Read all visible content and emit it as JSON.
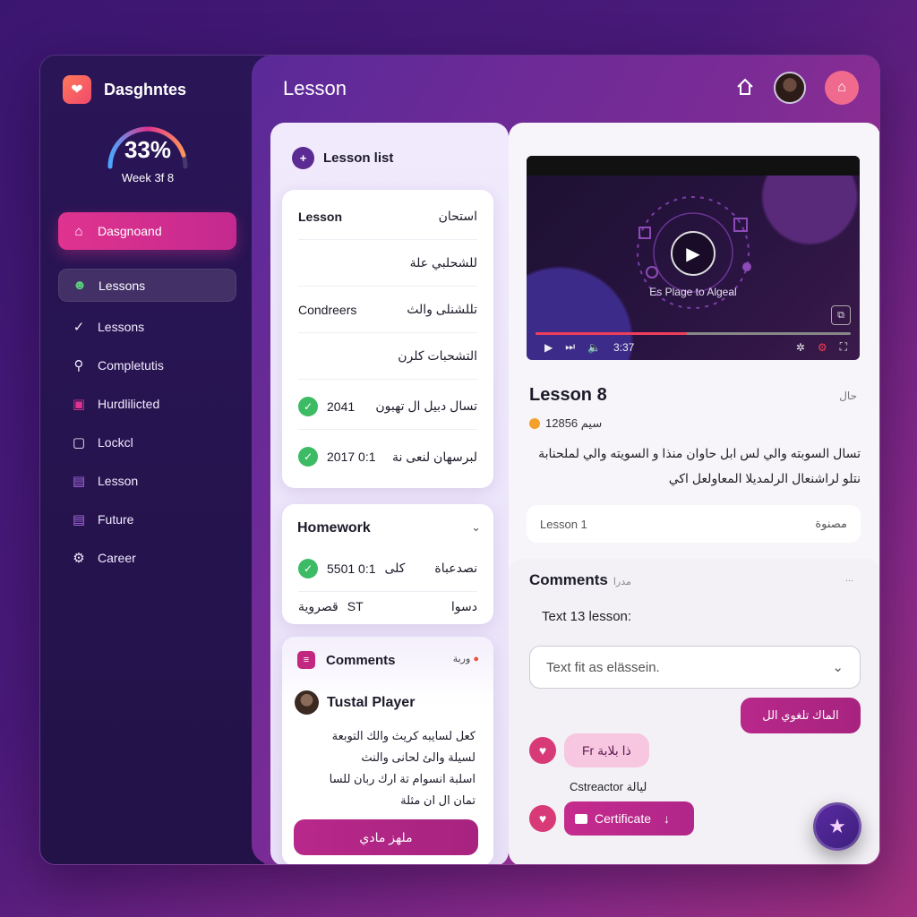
{
  "brand": {
    "name": "Dasghntes",
    "accent": "#e0338f"
  },
  "progress": {
    "percent_label": "33%",
    "fraction": 0.33,
    "week_label": "Week 3f 8"
  },
  "sidebar": {
    "items": [
      {
        "label": "Dasgnoand",
        "icon": "home-icon"
      },
      {
        "label": "Lessons",
        "icon": "people-icon"
      },
      {
        "label": "Lessons",
        "icon": "check-icon"
      },
      {
        "label": "Completutis",
        "icon": "search-icon"
      },
      {
        "label": "Hurdlilicted",
        "icon": "badge-icon"
      },
      {
        "label": "Lockcl",
        "icon": "lock-icon"
      },
      {
        "label": "Lesson",
        "icon": "lock-icon"
      },
      {
        "label": "Future",
        "icon": "lock-icon"
      },
      {
        "label": "Career",
        "icon": "gear-icon"
      }
    ]
  },
  "header": {
    "title": "Lesson"
  },
  "lesson_list": {
    "title": "Lesson list",
    "rows": [
      {
        "left": "Lesson",
        "right": "استحان"
      },
      {
        "left": "",
        "right": "للشحلبي علة"
      },
      {
        "left": "Condreers",
        "right": "تللشنلى والث"
      },
      {
        "left": "",
        "right": "التشحبات كلرن"
      },
      {
        "left": "2041",
        "right": "تسال دبيل ال تهبون",
        "done": true
      },
      {
        "left": "2017 0:1",
        "right": "لبرسهان لنعى نة",
        "done": true
      }
    ]
  },
  "homework": {
    "title": "Homework",
    "rows": [
      {
        "left": "5501 0:1",
        "mid": "كلى",
        "right": "نصدعباة",
        "done": true
      },
      {
        "left": "ST",
        "mid": "قصروية",
        "right": "دسوا"
      }
    ]
  },
  "comments_left": {
    "title": "Comments",
    "badge": "وربة",
    "author": "Tustal Player",
    "lines": [
      "كعل لسايبه كريث والك التوبعة",
      "لسيلة والئ لحانى والنث",
      "اسلبة انسوام تة ارك ربان للسا",
      "تمان ال ان مثلة"
    ],
    "reply_label": "ملهز مادي"
  },
  "video": {
    "caption": "Es Plage to Algeal",
    "time": "3:37",
    "progress": 0.48
  },
  "lesson": {
    "title": "Lesson 8",
    "tag": "حال",
    "meta": "12856 سيم",
    "description": "تسال السوبته والي لس ابل حاوان منذا و السويته والي لملحنابة نتلو لراشنعال الرلمديلا المعاولعل اكي",
    "section_left": "Lesson 1",
    "section_right": "مصنوة"
  },
  "comments_right": {
    "title": "Comments",
    "subtitle": "مدرا",
    "dots": "...",
    "label": "Text 13 lesson:",
    "placeholder": "Text fit as elässein.",
    "send_label": "الماك تلغوي الل",
    "bubble": "Fr ذا بلابة",
    "instructor": "Cstreactor ليالة",
    "certificate": "Certificate"
  }
}
